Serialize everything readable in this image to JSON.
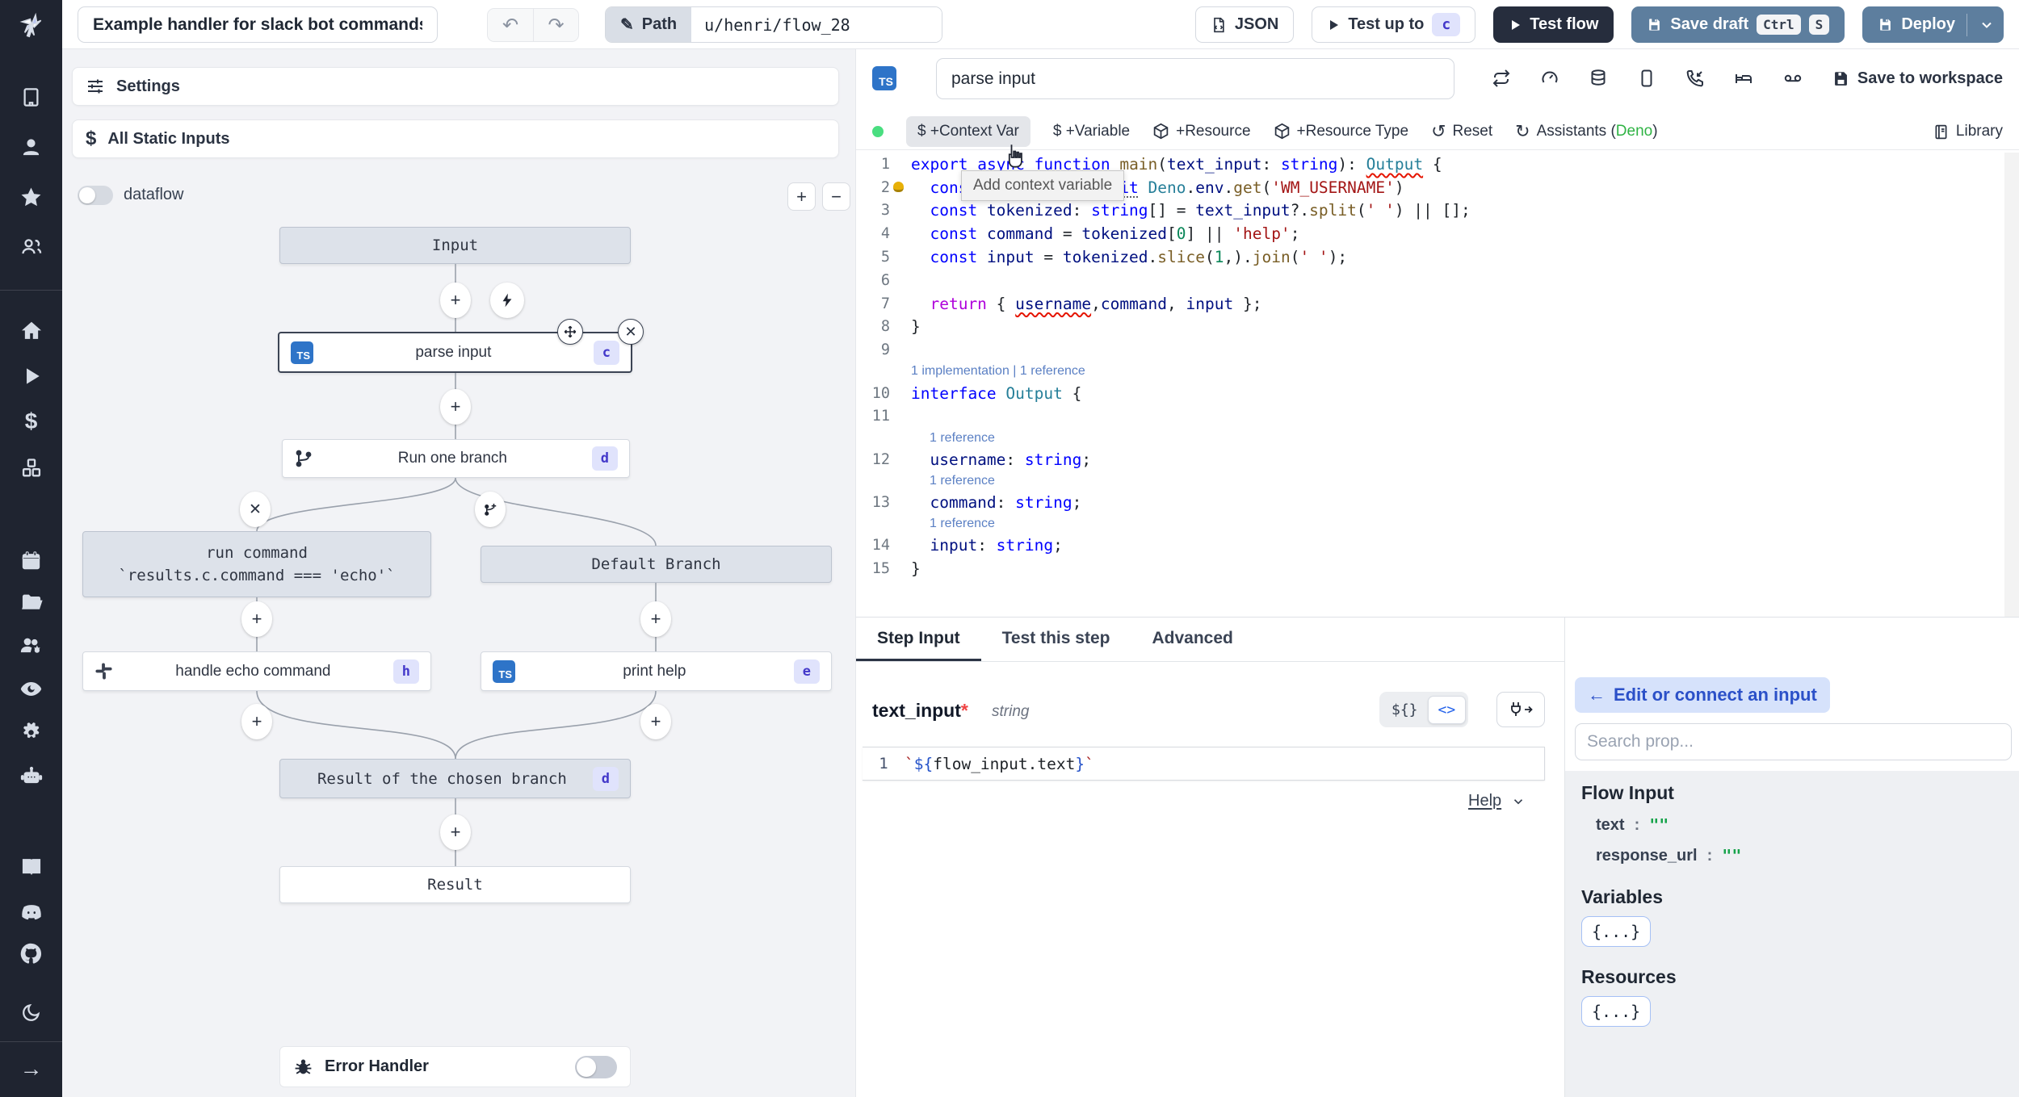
{
  "topbar": {
    "title_value": "Example handler for slack bot commands",
    "path_label": "Path",
    "path_value": "u/henri/flow_28",
    "json_label": "JSON",
    "test_up_to_label": "Test up to",
    "test_up_to_badge": "c",
    "test_flow_label": "Test flow",
    "save_draft_label": "Save draft",
    "kbd_ctrl": "Ctrl",
    "kbd_s": "S",
    "deploy_label": "Deploy"
  },
  "sidebar": {
    "icons": [
      "windmill-logo",
      "building",
      "user",
      "star",
      "users",
      "home",
      "play",
      "dollar",
      "cubes",
      "calendar",
      "folder",
      "users-gear",
      "eye",
      "gear",
      "robot",
      "book",
      "discord",
      "github",
      "moon",
      "arrow-right"
    ]
  },
  "flow": {
    "settings_label": "Settings",
    "static_inputs_label": "All Static Inputs",
    "dataflow_label": "dataflow",
    "zoom_in": "+",
    "zoom_out": "−",
    "error_handler_label": "Error Handler",
    "nodes": {
      "input": {
        "label": "Input"
      },
      "parse_input": {
        "label": "parse input",
        "badge": "c"
      },
      "run_one_branch": {
        "label": "Run one branch",
        "badge": "d"
      },
      "run_command": {
        "line1": "run command",
        "line2": "`results.c.command === 'echo'`"
      },
      "default_branch": {
        "label": "Default Branch"
      },
      "handle_echo": {
        "label": "handle echo command",
        "badge": "h"
      },
      "print_help": {
        "label": "print help",
        "badge": "e"
      },
      "result_chosen": {
        "label": "Result of the chosen branch",
        "badge": "d"
      },
      "result": {
        "label": "Result"
      }
    }
  },
  "editor": {
    "name_value": "parse input",
    "save_to_workspace": "Save to workspace",
    "toolbar": {
      "context_var": "$ +Context Var",
      "variable": "$ +Variable",
      "resource": "+Resource",
      "resource_type": "+Resource Type",
      "reset": "Reset",
      "assistants_prefix": "Assistants (",
      "assistants_lang": "Deno",
      "assistants_suffix": ")",
      "library": "Library"
    },
    "tooltip": "Add context variable",
    "code": {
      "lines": [
        {
          "n": 1,
          "t": [
            [
              "kw",
              "export"
            ],
            [
              "pl",
              " "
            ],
            [
              "kw",
              "async"
            ],
            [
              "pl",
              " "
            ],
            [
              "kw",
              "function"
            ],
            [
              "pl",
              " "
            ],
            [
              "fn",
              "main"
            ],
            [
              "pl",
              "("
            ],
            [
              "v",
              "text_input"
            ],
            [
              "pl",
              ": "
            ],
            [
              "t2",
              "string"
            ],
            [
              "pl",
              "): "
            ],
            [
              "tysq",
              "Output"
            ],
            [
              "pl",
              " {"
            ]
          ]
        },
        {
          "n": 2,
          "bulb": true,
          "t": [
            [
              "pl",
              "  "
            ],
            [
              "kw",
              "const"
            ],
            [
              "pl",
              " "
            ],
            [
              "v",
              "username"
            ],
            [
              "pl",
              " = "
            ],
            [
              "kwu",
              "await"
            ],
            [
              "pl",
              " "
            ],
            [
              "ty",
              "Deno"
            ],
            [
              "pl",
              "."
            ],
            [
              "v",
              "env"
            ],
            [
              "pl",
              "."
            ],
            [
              "fn",
              "get"
            ],
            [
              "pl",
              "("
            ],
            [
              "str",
              "'WM_USERNAME'"
            ],
            [
              "pl",
              ")"
            ]
          ]
        },
        {
          "n": 3,
          "t": [
            [
              "pl",
              "  "
            ],
            [
              "kw",
              "const"
            ],
            [
              "pl",
              " "
            ],
            [
              "v",
              "tokenized"
            ],
            [
              "pl",
              ": "
            ],
            [
              "t2",
              "string"
            ],
            [
              "pl",
              "[] = "
            ],
            [
              "v",
              "text_input"
            ],
            [
              "pl",
              "?."
            ],
            [
              "fn",
              "split"
            ],
            [
              "pl",
              "("
            ],
            [
              "str",
              "' '"
            ],
            [
              "pl",
              ") || [];"
            ]
          ]
        },
        {
          "n": 4,
          "t": [
            [
              "pl",
              "  "
            ],
            [
              "kw",
              "const"
            ],
            [
              "pl",
              " "
            ],
            [
              "v",
              "command"
            ],
            [
              "pl",
              " = "
            ],
            [
              "v",
              "tokenized"
            ],
            [
              "pl",
              "["
            ],
            [
              "num",
              "0"
            ],
            [
              "pl",
              "] || "
            ],
            [
              "str",
              "'help'"
            ],
            [
              "pl",
              ";"
            ]
          ]
        },
        {
          "n": 5,
          "t": [
            [
              "pl",
              "  "
            ],
            [
              "kw",
              "const"
            ],
            [
              "pl",
              " "
            ],
            [
              "v",
              "input"
            ],
            [
              "pl",
              " = "
            ],
            [
              "v",
              "tokenized"
            ],
            [
              "pl",
              "."
            ],
            [
              "fn",
              "slice"
            ],
            [
              "pl",
              "("
            ],
            [
              "num",
              "1"
            ],
            [
              "pl",
              ",)."
            ],
            [
              "fn",
              "join"
            ],
            [
              "pl",
              "("
            ],
            [
              "str",
              "' '"
            ],
            [
              "pl",
              ");"
            ]
          ]
        },
        {
          "n": 6,
          "t": []
        },
        {
          "n": 7,
          "t": [
            [
              "pl",
              "  "
            ],
            [
              "ctl",
              "return"
            ],
            [
              "pl",
              " { "
            ],
            [
              "vsq",
              "username"
            ],
            [
              "pl",
              ","
            ],
            [
              "v",
              "command"
            ],
            [
              "pl",
              ", "
            ],
            [
              "v",
              "input"
            ],
            [
              "pl",
              " };"
            ]
          ]
        },
        {
          "n": 8,
          "t": [
            [
              "pl",
              "}"
            ]
          ]
        },
        {
          "n": 9,
          "t": []
        },
        {
          "lens": "1 implementation | 1 reference",
          "indent": 0
        },
        {
          "n": 10,
          "t": [
            [
              "kw",
              "interface"
            ],
            [
              "pl",
              " "
            ],
            [
              "ty",
              "Output"
            ],
            [
              "pl",
              " {"
            ]
          ]
        },
        {
          "n": 11,
          "t": [
            [
              "pl",
              "  "
            ]
          ]
        },
        {
          "lens": "1 reference",
          "indent": 23
        },
        {
          "n": 12,
          "t": [
            [
              "pl",
              "  "
            ],
            [
              "v",
              "username"
            ],
            [
              "pl",
              ": "
            ],
            [
              "t2",
              "string"
            ],
            [
              "pl",
              ";"
            ]
          ]
        },
        {
          "lens": "1 reference",
          "indent": 23
        },
        {
          "n": 13,
          "t": [
            [
              "pl",
              "  "
            ],
            [
              "v",
              "command"
            ],
            [
              "pl",
              ": "
            ],
            [
              "t2",
              "string"
            ],
            [
              "pl",
              ";"
            ]
          ]
        },
        {
          "lens": "1 reference",
          "indent": 23
        },
        {
          "n": 14,
          "t": [
            [
              "pl",
              "  "
            ],
            [
              "v",
              "input"
            ],
            [
              "pl",
              ": "
            ],
            [
              "t2",
              "string"
            ],
            [
              "pl",
              ";"
            ]
          ]
        },
        {
          "n": 15,
          "t": [
            [
              "pl",
              "}"
            ]
          ]
        }
      ]
    }
  },
  "step_panel": {
    "tabs": [
      {
        "label": "Step Input"
      },
      {
        "label": "Test this step"
      },
      {
        "label": "Advanced"
      }
    ],
    "field_name": "text_input",
    "required_mark": "*",
    "field_type": "string",
    "toggle_template": "${}",
    "toggle_code": "<>",
    "line_no": "1",
    "expr": [
      [
        "str",
        "`"
      ],
      [
        "kw2",
        "${"
      ],
      [
        "pl2",
        "flow_input.text"
      ],
      [
        "kw2",
        "}"
      ],
      [
        "str",
        "`"
      ]
    ],
    "help_label": "Help"
  },
  "connect_panel": {
    "back_arrow": "←",
    "back_label": "Edit or connect an input",
    "search_placeholder": "Search prop...",
    "flow_input_title": "Flow Input",
    "props": [
      {
        "name": "text",
        "colon": ":",
        "value": "\"\""
      },
      {
        "name": "response_url",
        "colon": ":",
        "value": "\"\""
      }
    ],
    "variables_title": "Variables",
    "variables_chip": "{...}",
    "resources_title": "Resources",
    "resources_chip": "{...}"
  },
  "colors": {
    "accent_steel": "#5d7e9e",
    "dark_button": "#262d3d",
    "sidebar_bg": "#1f2430",
    "badge_bg": "#e0e3fc",
    "badge_text": "#4338ca",
    "deno_green": "#2fb344",
    "status_green_dot": "#4ade80"
  }
}
